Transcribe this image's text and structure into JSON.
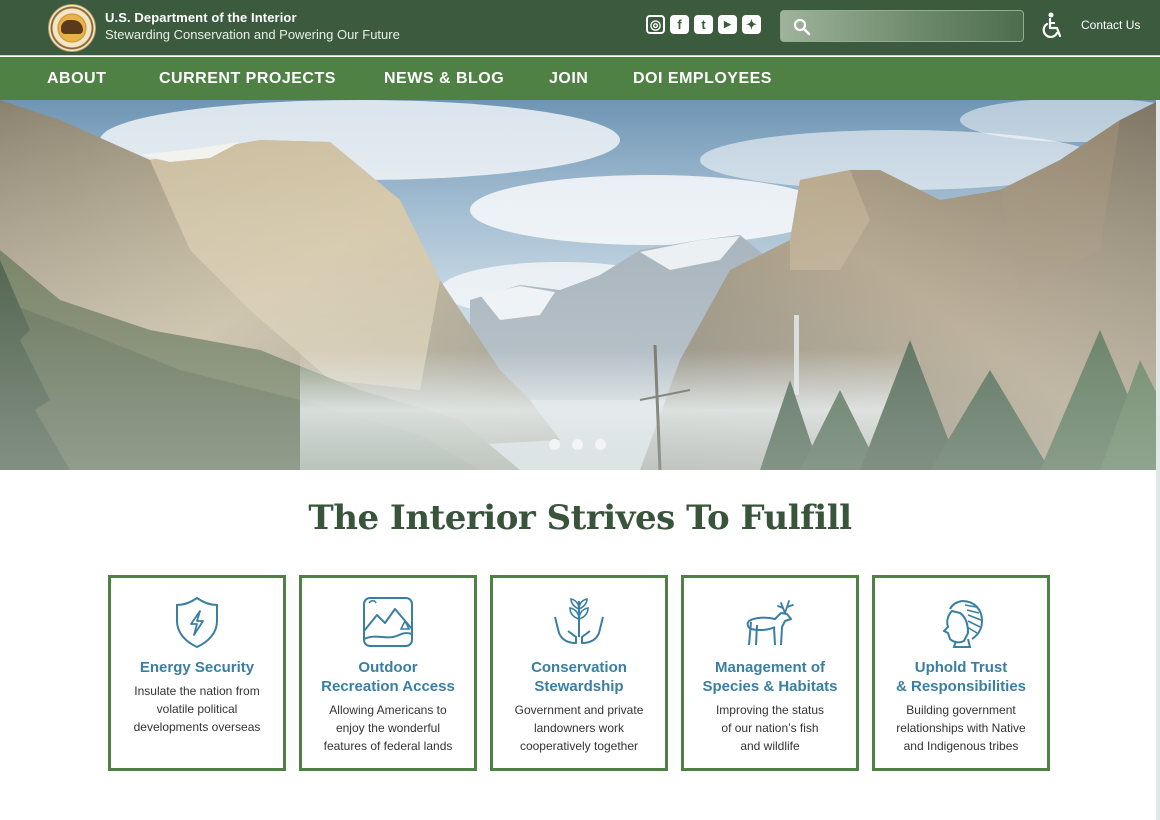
{
  "header": {
    "title": "U.S. Department of the Interior",
    "tagline": "Stewarding Conservation and Powering Our Future",
    "social": [
      {
        "icon": "instagram-icon",
        "glyph": "◎"
      },
      {
        "icon": "facebook-icon",
        "glyph": "f"
      },
      {
        "icon": "tumblr-icon",
        "glyph": "t"
      },
      {
        "icon": "youtube-icon",
        "glyph": "▶"
      },
      {
        "icon": "twitter-icon",
        "glyph": "✦"
      }
    ],
    "search_placeholder": "",
    "contact_label": "Contact Us"
  },
  "nav": {
    "items": [
      "ABOUT",
      "CURRENT PROJECTS",
      "NEWS & BLOG",
      "JOIN",
      "DOI EMPLOYEES"
    ]
  },
  "hero": {
    "slide_count": 3
  },
  "mission": {
    "title": "The Interior Strives To Fulfill",
    "cards": [
      {
        "icon": "shield-lightning-icon",
        "title": "Energy Security",
        "description": "Insulate the nation from\nvolatile political\ndevelopments overseas"
      },
      {
        "icon": "landscape-icon",
        "title": "Outdoor\nRecreation Access",
        "description": "Allowing Americans to\nenjoy the wonderful\nfeatures of federal lands"
      },
      {
        "icon": "hands-plant-icon",
        "title": "Conservation\nStewardship",
        "description": "Government and private\nlandowners work\ncooperatively together"
      },
      {
        "icon": "deer-icon",
        "title": "Management of\nSpecies & Habitats",
        "description": "Improving the status\nof our nation’s fish\nand wildlife"
      },
      {
        "icon": "native-headdress-icon",
        "title": "Uphold Trust\n& Responsibilities",
        "description": "Building government\nrelationships with Native\nand Indigenous tribes"
      }
    ]
  },
  "colors": {
    "header_bg": "#3c5a3e",
    "nav_bg": "#4e8143",
    "card_border": "#4e8143",
    "card_title": "#3a7fa3",
    "section_title": "#38543b"
  }
}
